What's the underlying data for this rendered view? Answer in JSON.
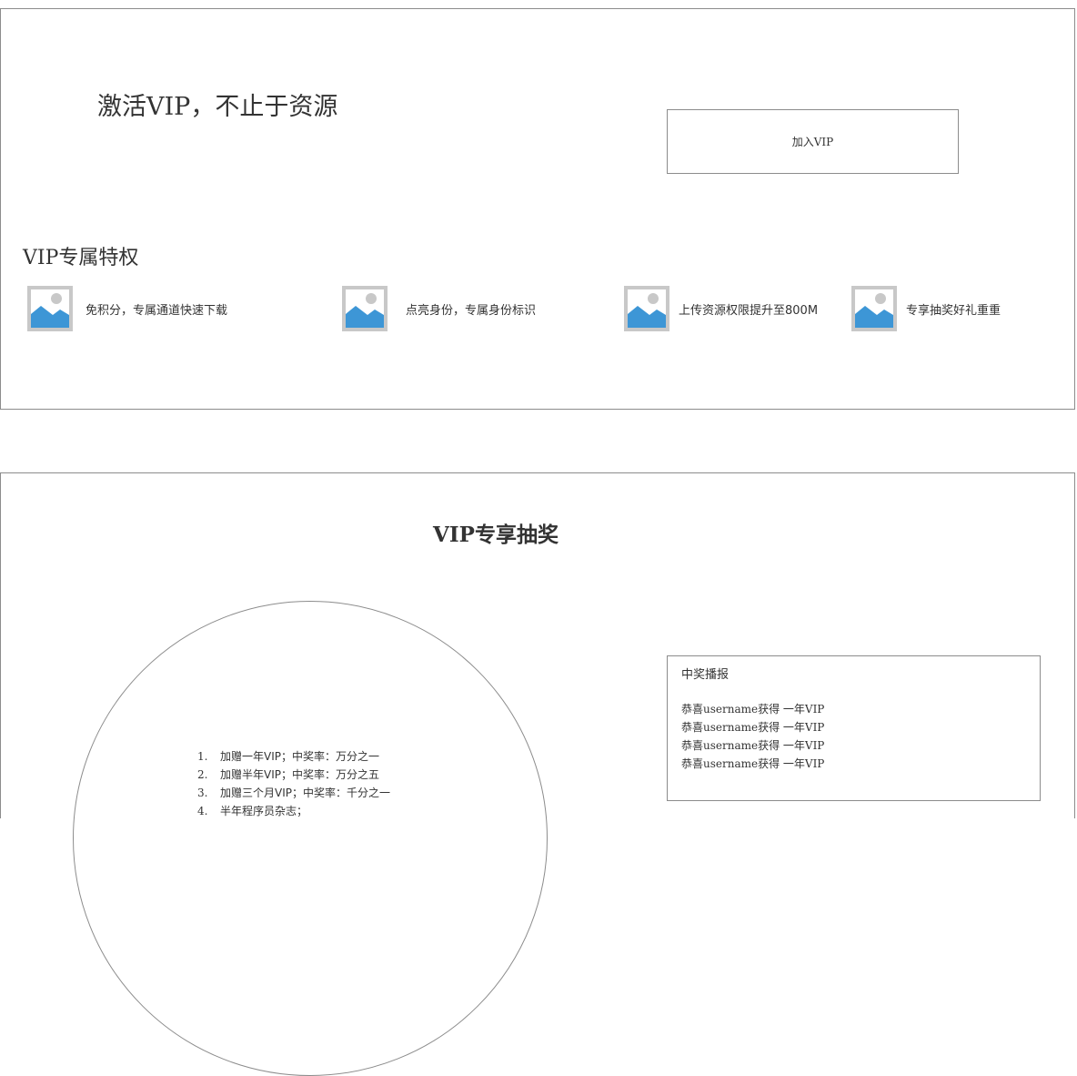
{
  "hero": {
    "title": "激活VIP，不止于资源",
    "join_button": "加入VIP"
  },
  "privileges": {
    "title": "VIP专属特权",
    "items": [
      {
        "icon": "image-placeholder-icon",
        "label": "免积分，专属通道快速下载"
      },
      {
        "icon": "image-placeholder-icon",
        "label": "点亮身份，专属身份标识"
      },
      {
        "icon": "image-placeholder-icon",
        "label": "上传资源权限提升至800M"
      },
      {
        "icon": "image-placeholder-icon",
        "label": "专享抽奖好礼重重"
      }
    ]
  },
  "lottery": {
    "title": "VIP专享抽奖",
    "prizes": [
      {
        "num": "1.",
        "text": "加赠一年VIP；中奖率：万分之一"
      },
      {
        "num": "2.",
        "text": "加赠半年VIP；中奖率：万分之五"
      },
      {
        "num": "3.",
        "text": "加赠三个月VIP；中奖率：千分之一"
      },
      {
        "num": "4.",
        "text": "半年程序员杂志；"
      }
    ]
  },
  "broadcast": {
    "title": "中奖播报",
    "messages": [
      "恭喜username获得 一年VIP",
      "恭喜username获得 一年VIP",
      "恭喜username获得 一年VIP",
      "恭喜username获得 一年VIP"
    ]
  },
  "colors": {
    "border": "#8c8c8c",
    "text": "#333333",
    "placeholder_bg": "#c8c8c8",
    "placeholder_mountain": "#3d96d6",
    "placeholder_sun": "#c8c8c8"
  }
}
